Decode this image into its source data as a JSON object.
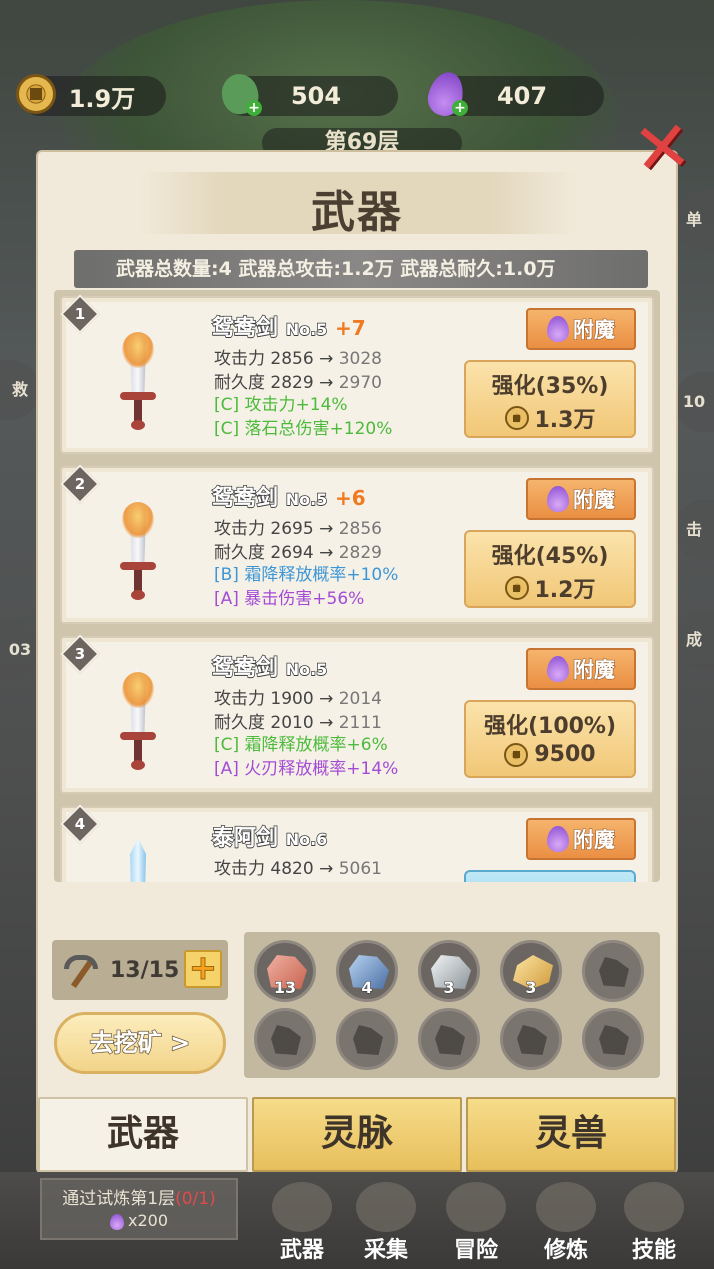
{
  "resources": [
    {
      "icon": "copper-coin-icon",
      "value": "1.9万"
    },
    {
      "icon": "green-gem-icon",
      "value": "504"
    },
    {
      "icon": "purple-flame-icon",
      "value": "407"
    }
  ],
  "floor_label": "第69层",
  "side_labels": {
    "left_1": "救",
    "left_2": "03",
    "right_1": "单",
    "right_2": "10",
    "right_3": "击",
    "right_4": "成"
  },
  "panel": {
    "title": "武器",
    "stats": "武器总数量:4  武器总攻击:1.2万  武器总耐久:1.0万"
  },
  "weapons": [
    {
      "index": "1",
      "name": "鸳鸯剑",
      "level": "No.5",
      "plus": "+7",
      "atk_label": "攻击力",
      "atk": "2856",
      "atk_next": "3028",
      "dur_label": "耐久度",
      "dur": "2829",
      "dur_next": "2970",
      "affix1": "[C] 攻击力+14%",
      "affix1_color": "green",
      "affix2": "[C] 落石总伤害+120%",
      "affix2_color": "green",
      "enchant": "附魔",
      "upgrade": "强化(35%)",
      "cost": "1.3万"
    },
    {
      "index": "2",
      "name": "鸳鸯剑",
      "level": "No.5",
      "plus": "+6",
      "atk_label": "攻击力",
      "atk": "2695",
      "atk_next": "2856",
      "dur_label": "耐久度",
      "dur": "2694",
      "dur_next": "2829",
      "affix1": "[B] 霜降释放概率+10%",
      "affix1_color": "blue",
      "affix2": "[A] 暴击伤害+56%",
      "affix2_color": "purple",
      "enchant": "附魔",
      "upgrade": "强化(45%)",
      "cost": "1.2万"
    },
    {
      "index": "3",
      "name": "鸳鸯剑",
      "level": "No.5",
      "plus": "",
      "atk_label": "攻击力",
      "atk": "1900",
      "atk_next": "2014",
      "dur_label": "耐久度",
      "dur": "2010",
      "dur_next": "2111",
      "affix1": "[C] 霜降释放概率+6%",
      "affix1_color": "green",
      "affix2": "[A] 火刃释放概率+14%",
      "affix2_color": "purple",
      "enchant": "附魔",
      "upgrade": "强化(100%)",
      "cost": "9500"
    },
    {
      "index": "4",
      "name": "泰阿剑",
      "level": "No.6",
      "plus": "",
      "atk_label": "攻击力",
      "atk": "4820",
      "atk_next": "5061",
      "enchant": "附魔"
    }
  ],
  "mining": {
    "pickaxe_count": "13/15",
    "dig_button": "去挖矿 >",
    "ores": [
      {
        "type": "red-ore",
        "count": "13"
      },
      {
        "type": "blue-ore",
        "count": "4"
      },
      {
        "type": "silver-ore",
        "count": "3"
      },
      {
        "type": "gold-ore",
        "count": "3"
      }
    ]
  },
  "tabs": [
    "武器",
    "灵脉",
    "灵兽"
  ],
  "quest": {
    "text": "通过试炼第1层",
    "progress": "(0/1)",
    "reward": "x200"
  },
  "nav": [
    "武器",
    "采集",
    "冒险",
    "修炼",
    "技能"
  ]
}
